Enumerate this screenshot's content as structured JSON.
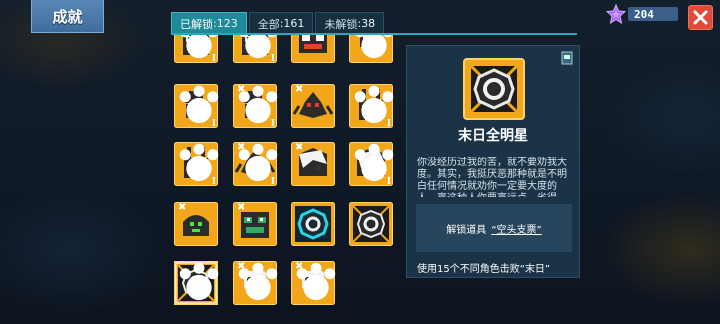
{
  "header": {
    "title": "成就"
  },
  "currency": {
    "icon": "purple-gem-icon",
    "amount": "204"
  },
  "close": {
    "icon": "close-icon"
  },
  "tabs": [
    {
      "label": "已解锁",
      "count": ":123",
      "active": true
    },
    {
      "label": "全部",
      "count": ":161",
      "active": false
    },
    {
      "label": "未解锁",
      "count": ":38",
      "active": false
    }
  ],
  "grid": {
    "rank_label": "I",
    "items": [
      {
        "icon": "glasses-robot-icon",
        "rank": "I"
      },
      {
        "icon": "glasses-robot-icon",
        "rank": "I"
      },
      {
        "icon": "black-mech-icon",
        "rank": ""
      },
      {
        "icon": "helmet-icon",
        "rank": ""
      },
      {
        "icon": "top-hat-icon",
        "rank": "I"
      },
      {
        "icon": "top-hat-icon",
        "rank": "I"
      },
      {
        "icon": "red-spider-icon",
        "rank": ""
      },
      {
        "icon": "rabbit-robot-icon",
        "rank": "I"
      },
      {
        "icon": "rabbit-robot-icon",
        "rank": "I"
      },
      {
        "icon": "red-spider-icon",
        "rank": "I"
      },
      {
        "icon": "white-hair-icon",
        "rank": ""
      },
      {
        "icon": "white-hair-icon",
        "rank": "I"
      },
      {
        "icon": "green-dome-icon",
        "rank": ""
      },
      {
        "icon": "green-robot-icon",
        "rank": ""
      },
      {
        "icon": "cyan-doomsday-icon",
        "rank": ""
      },
      {
        "icon": "doomsday-gear-icon",
        "rank": ""
      },
      {
        "icon": "doomsday-star-icon",
        "rank": ""
      },
      {
        "icon": "skull-icon",
        "rank": ""
      },
      {
        "icon": "skull-icon",
        "rank": ""
      }
    ]
  },
  "detail": {
    "icon": "doomsday-star-icon",
    "name": "末日全明星",
    "description": "你没经历过我的苦，就不要劝我大度。其实，我挺厌恶那种就是不明白任何情况就劝你一定要大度的人，离这种人你要离远点，省得",
    "unlock_label": "解锁道具",
    "unlock_item": "“空头支票”",
    "condition": "使用15个不同角色击败“末日”"
  },
  "colors": {
    "orange": "#f2a71b",
    "accent": "#25a9bd",
    "panel": "#1a3346",
    "close": "#e04a38"
  }
}
